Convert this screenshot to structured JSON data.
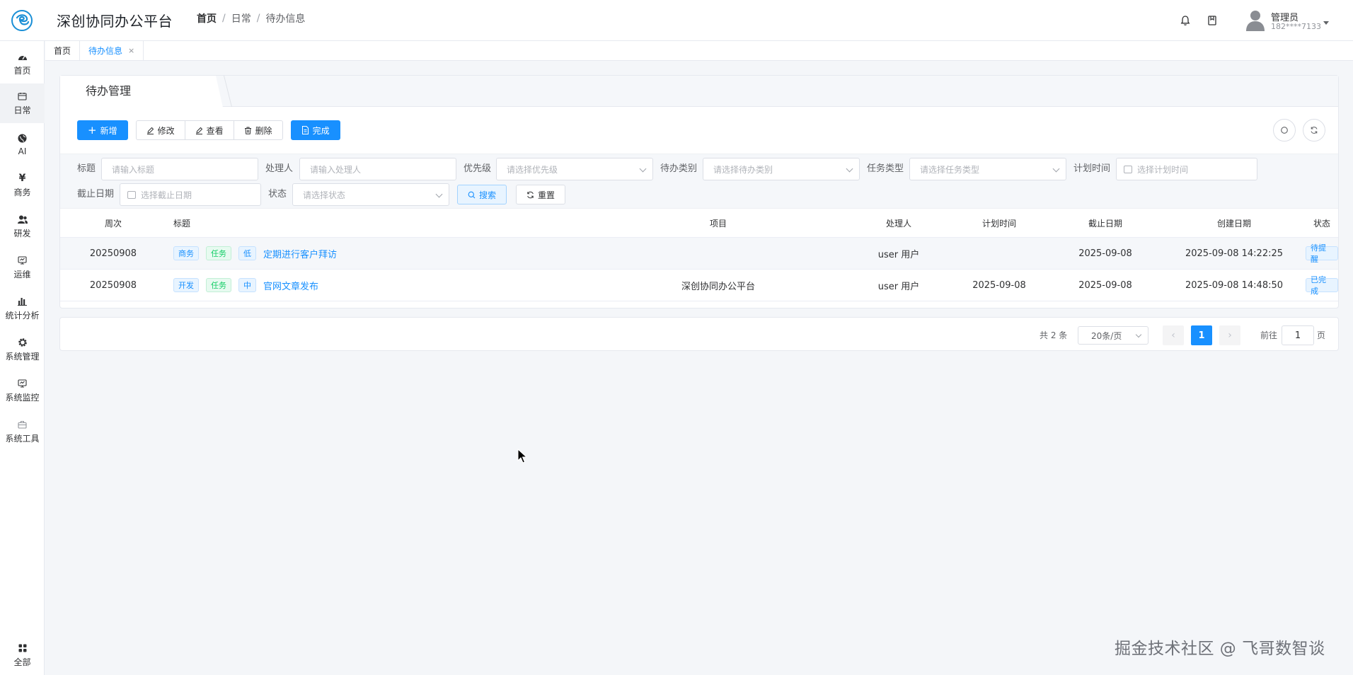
{
  "header": {
    "app_title": "深创协同办公平台",
    "breadcrumb": [
      "首页",
      "日常",
      "待办信息"
    ],
    "breadcrumb_sep": "/",
    "user_name": "管理员",
    "user_phone": "182****7133"
  },
  "sidebar": {
    "items": [
      {
        "label": "首页",
        "icon": "dashboard-icon"
      },
      {
        "label": "日常",
        "icon": "calendar-icon",
        "active": true
      },
      {
        "label": "AI",
        "icon": "globe-icon"
      },
      {
        "label": "商务",
        "icon": "yen-icon"
      },
      {
        "label": "研发",
        "icon": "users-icon"
      },
      {
        "label": "运维",
        "icon": "monitor-icon"
      },
      {
        "label": "统计分析",
        "icon": "bar-chart-icon"
      },
      {
        "label": "系统管理",
        "icon": "gear-icon"
      },
      {
        "label": "系统监控",
        "icon": "monitor-icon"
      },
      {
        "label": "系统工具",
        "icon": "toolbox-icon"
      }
    ],
    "bottom_item": {
      "label": "全部",
      "icon": "grid-icon"
    }
  },
  "tags": [
    {
      "label": "首页",
      "active": false
    },
    {
      "label": "待办信息",
      "active": true,
      "close": "×"
    }
  ],
  "panel": {
    "tab_title": "待办管理",
    "toolbar": {
      "add": "新增",
      "edit": "修改",
      "view": "查看",
      "delete": "删除",
      "done": "完成"
    },
    "filters": {
      "title_label": "标题",
      "title_placeholder": "请输入标题",
      "handler_label": "处理人",
      "handler_placeholder": "请输入处理人",
      "priority_label": "优先级",
      "priority_placeholder": "请选择优先级",
      "category_label": "待办类别",
      "category_placeholder": "请选择待办类别",
      "task_type_label": "任务类型",
      "task_type_placeholder": "请选择任务类型",
      "plan_time_label": "计划时间",
      "plan_time_placeholder": "选择计划时间",
      "deadline_label": "截止日期",
      "deadline_placeholder": "选择截止日期",
      "status_label": "状态",
      "status_placeholder": "请选择状态",
      "search_button": "搜索",
      "reset_button": "重置"
    },
    "table": {
      "columns": [
        "周次",
        "标题",
        "项目",
        "处理人",
        "计划时间",
        "截止日期",
        "创建日期",
        "状态"
      ],
      "rows": [
        {
          "week": "20250908",
          "tags": [
            "商务",
            "任务",
            "低"
          ],
          "title": "定期进行客户拜访",
          "project": "",
          "handler": "user  用户",
          "plan_time": "",
          "deadline": "2025-09-08",
          "created": "2025-09-08 14:22:25",
          "status": "待提醒"
        },
        {
          "week": "20250908",
          "tags": [
            "开发",
            "任务",
            "中"
          ],
          "title": "官网文章发布",
          "project": "深创协同办公平台",
          "handler": "user  用户",
          "plan_time": "2025-09-08",
          "deadline": "2025-09-08",
          "created": "2025-09-08 14:48:50",
          "status": "已完成"
        }
      ]
    }
  },
  "pagination": {
    "total": "共 2 条",
    "page_size": "20条/页",
    "prev": "‹",
    "current": "1",
    "next": "›",
    "goto_label": "前往",
    "goto_value": "1",
    "goto_unit": "页"
  },
  "watermark": "掘金技术社区 @ 飞哥数智谈",
  "colors": {
    "primary": "#1890ff",
    "success": "#13ce66",
    "background": "#f4f6f9"
  }
}
